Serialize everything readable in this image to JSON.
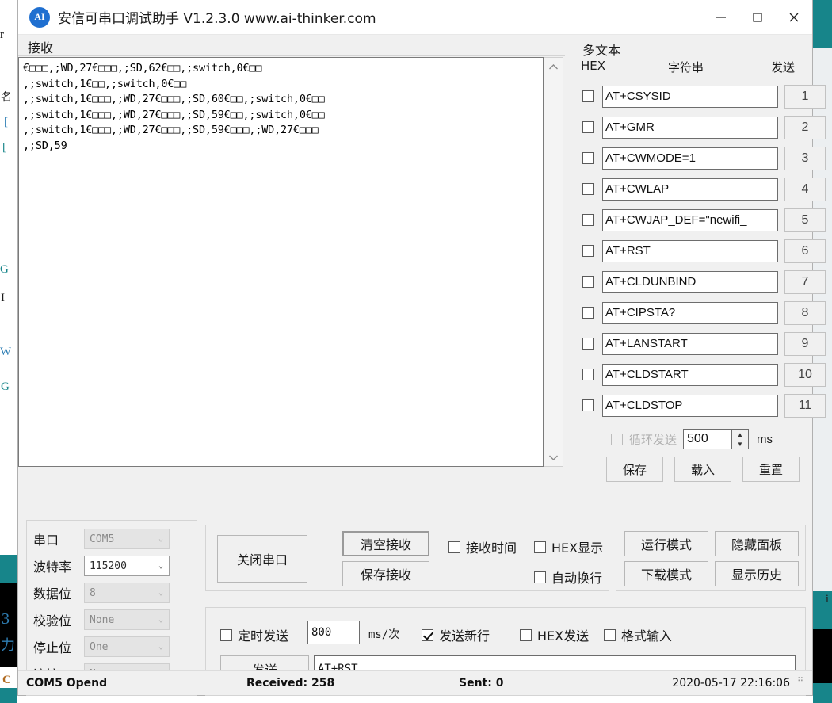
{
  "window": {
    "title": "安信可串口调试助手 V1.2.3.0    www.ai-thinker.com",
    "logo_text": "AI",
    "minimize_label": "minimize",
    "maximize_label": "maximize",
    "close_label": "close"
  },
  "receive": {
    "group_label": "接收",
    "text": "€□□□,;WD,27€□□□,;SD,62€□□,;switch,0€□□\n,;switch,1€□□,;switch,0€□□\n,;switch,1€□□□,;WD,27€□□□,;SD,60€□□,;switch,0€□□\n,;switch,1€□□□,;WD,27€□□□,;SD,59€□□,;switch,0€□□\n,;switch,1€□□□,;WD,27€□□□,;SD,59€□□□,;WD,27€□□□\n,;SD,59",
    "scroll_up_icon": "chevron-up-icon",
    "scroll_down_icon": "chevron-down-icon"
  },
  "multitext": {
    "title": "多文本",
    "col_hex": "HEX",
    "col_string": "字符串",
    "col_send": "发送",
    "rows": [
      {
        "hex_checked": false,
        "command": "AT+CSYSID",
        "send_label": "1"
      },
      {
        "hex_checked": false,
        "command": "AT+GMR",
        "send_label": "2"
      },
      {
        "hex_checked": false,
        "command": "AT+CWMODE=1",
        "send_label": "3"
      },
      {
        "hex_checked": false,
        "command": "AT+CWLAP",
        "send_label": "4"
      },
      {
        "hex_checked": false,
        "command": "AT+CWJAP_DEF=\"newifi_",
        "send_label": "5"
      },
      {
        "hex_checked": false,
        "command": "AT+RST",
        "send_label": "6"
      },
      {
        "hex_checked": false,
        "command": "AT+CLDUNBIND",
        "send_label": "7"
      },
      {
        "hex_checked": false,
        "command": "AT+CIPSTA?",
        "send_label": "8"
      },
      {
        "hex_checked": false,
        "command": "AT+LANSTART",
        "send_label": "9"
      },
      {
        "hex_checked": false,
        "command": "AT+CLDSTART",
        "send_label": "10"
      },
      {
        "hex_checked": false,
        "command": "AT+CLDSTOP",
        "send_label": "11"
      }
    ],
    "loop_send_label": "循环发送",
    "loop_send_checked": false,
    "loop_send_enabled": false,
    "loop_interval": "500",
    "loop_unit": "ms",
    "save_label": "保存",
    "load_label": "载入",
    "reset_label": "重置"
  },
  "serial": {
    "rows": [
      {
        "label": "串口",
        "value": "COM5",
        "enabled": false
      },
      {
        "label": "波特率",
        "value": "115200",
        "enabled": true
      },
      {
        "label": "数据位",
        "value": "8",
        "enabled": false
      },
      {
        "label": "校验位",
        "value": "None",
        "enabled": false
      },
      {
        "label": "停止位",
        "value": "One",
        "enabled": false
      },
      {
        "label": "流控",
        "value": "None",
        "enabled": false
      }
    ]
  },
  "controls": {
    "close_port": "关闭串口",
    "clear_recv": "清空接收",
    "save_recv": "保存接收",
    "chk_recv_time": {
      "label": "接收时间",
      "checked": false
    },
    "chk_hex_show": {
      "label": "HEX显示",
      "checked": false
    },
    "chk_auto_wrap": {
      "label": "自动换行",
      "checked": false
    }
  },
  "modes": {
    "run_mode": "运行模式",
    "download_mode": "下载模式",
    "hide_panel": "隐藏面板",
    "show_history": "显示历史"
  },
  "send": {
    "chk_timed": {
      "label": "定时发送",
      "checked": false
    },
    "interval": "800",
    "interval_unit": "ms/次",
    "chk_newline": {
      "label": "发送新行",
      "checked": true
    },
    "chk_hex_send": {
      "label": "HEX发送",
      "checked": false
    },
    "chk_format_input": {
      "label": "格式输入",
      "checked": false
    },
    "send_button": "发送",
    "send_value": "AT+RST"
  },
  "status": {
    "port": "COM5 Opend",
    "received": "Received: 258",
    "sent": "Sent: 0",
    "datetime": "2020-05-17 22:16:06"
  },
  "background": {
    "frag_r": "r",
    "frag_cn1": "名",
    "frag_br1": "[",
    "frag_br2": "[",
    "frag_g1": "G",
    "frag_i": "I",
    "frag_w": "W",
    "frag_g2": "G",
    "frag_3": "3",
    "frag_cn2": "力",
    "frag_c": "C",
    "frag_i2": "i"
  },
  "colors": {
    "accent_teal": "#17858a",
    "logo_blue": "#1f6fd0",
    "window_bg": "#f0f0f0",
    "field_bg": "#ffffff"
  }
}
